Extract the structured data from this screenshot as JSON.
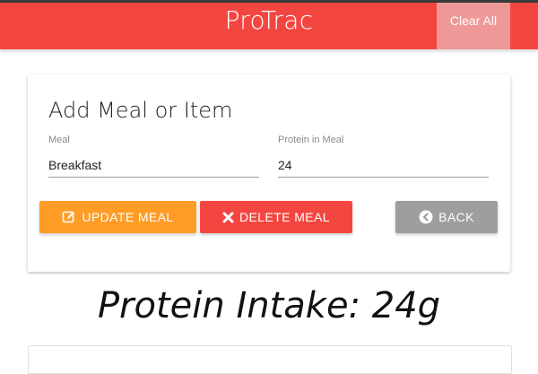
{
  "header": {
    "brand": "ProTrac",
    "clear_all_label": "Clear All",
    "colors": {
      "primary": "#f44641",
      "clear_button": "#ee9898"
    }
  },
  "form": {
    "title": "Add Meal or Item",
    "meal_label": "Meal",
    "meal_value": "Breakfast",
    "protein_label": "Protein in Meal",
    "protein_value": "24",
    "update_label": "UPDATE MEAL",
    "update_icon": "edit-icon",
    "delete_label": "DELETE MEAL",
    "delete_icon": "close-icon",
    "back_label": "BACK",
    "back_icon": "chevron-left-circle-icon",
    "colors": {
      "update": "#ff9c25",
      "delete": "#f44641",
      "back": "#9e9e9e"
    }
  },
  "summary": {
    "protein_intake": "Protein Intake: 24g"
  }
}
